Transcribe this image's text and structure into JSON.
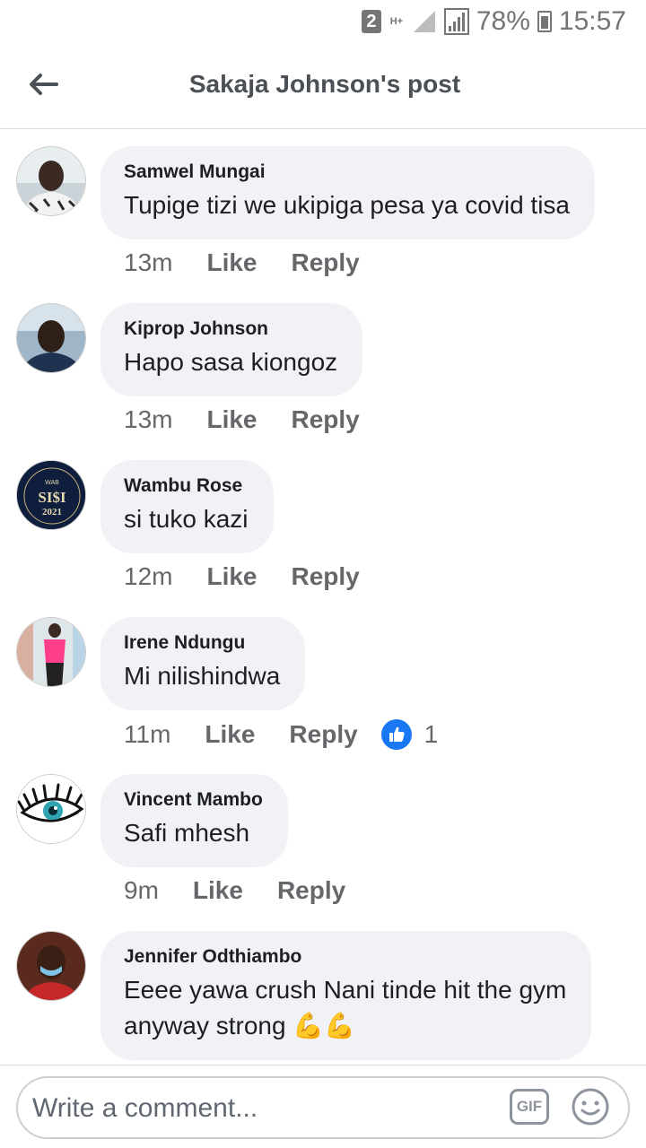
{
  "status_bar": {
    "sim": "2",
    "network": "H+",
    "battery": "78%",
    "time": "15:57"
  },
  "header": {
    "title": "Sakaja Johnson's post"
  },
  "comments": [
    {
      "author": "Samwel Mungai",
      "text": "Tupige tizi we ukipiga pesa ya covid tisa",
      "time": "13m",
      "like": "Like",
      "reply": "Reply"
    },
    {
      "author": "Kiprop Johnson",
      "text": "Hapo sasa kiongoz",
      "time": "13m",
      "like": "Like",
      "reply": "Reply"
    },
    {
      "author": "Wambu Rose",
      "text": "si tuko kazi",
      "time": "12m",
      "like": "Like",
      "reply": "Reply"
    },
    {
      "author": "Irene Ndungu",
      "text": "Mi nilishindwa",
      "time": "11m",
      "like": "Like",
      "reply": "Reply",
      "reactions": "1"
    },
    {
      "author": "Vincent Mambo",
      "text": "Safi mhesh",
      "time": "9m",
      "like": "Like",
      "reply": "Reply"
    },
    {
      "author": "Jennifer Odthiambo",
      "text": "Eeee yawa crush Nani tinde hit the gym",
      "text2": "anyway strong 💪💪"
    }
  ],
  "composer": {
    "placeholder": "Write a comment...",
    "gif_label": "GIF"
  },
  "avatar_badge": {
    "line1": "WAB",
    "line2": "SI$I",
    "line3": "2021"
  },
  "colors": {
    "accent": "#1877f2",
    "bubble": "#f0f2f5",
    "meta": "#65676b"
  }
}
